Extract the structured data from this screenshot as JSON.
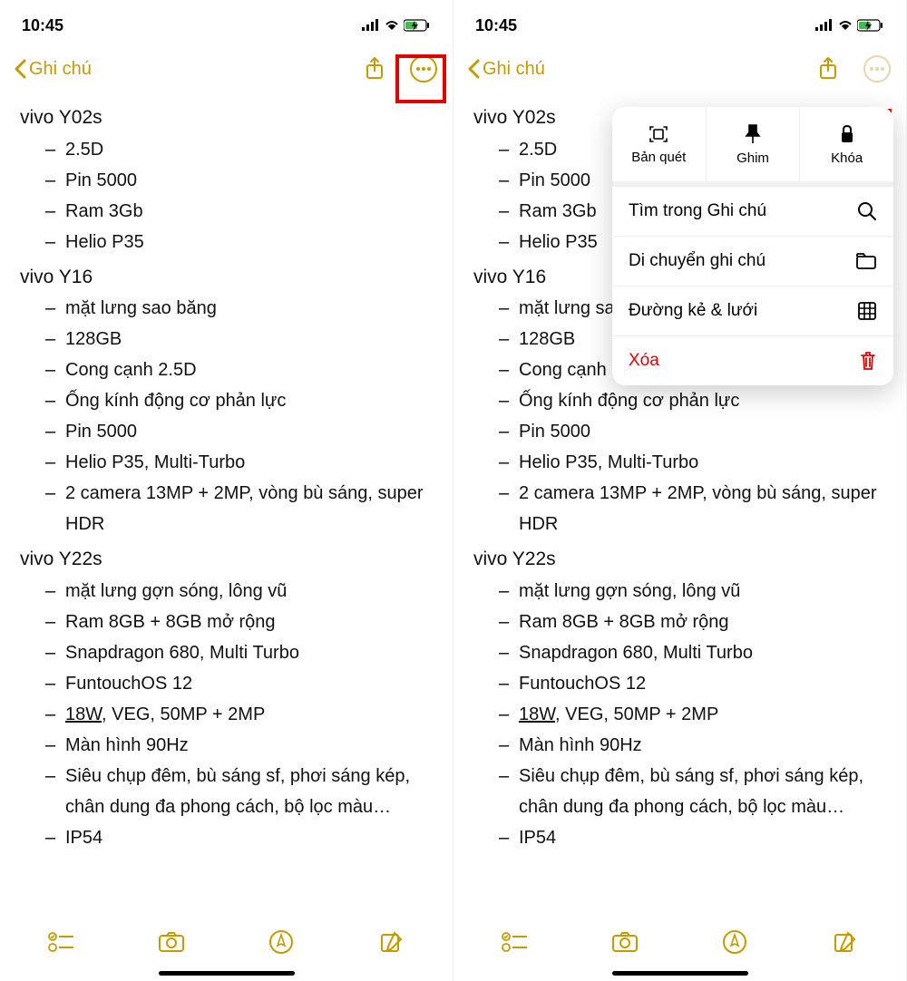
{
  "status": {
    "time": "10:45"
  },
  "nav": {
    "back_label": "Ghi chú"
  },
  "note": {
    "sections": [
      {
        "title": "vivo Y02s",
        "items": [
          "2.5D",
          "Pin 5000",
          "Ram 3Gb",
          "Helio P35"
        ]
      },
      {
        "title": "vivo Y16",
        "items": [
          "mặt lưng sao băng",
          "128GB",
          "Cong cạnh 2.5D",
          "Ống kính động cơ phản lực",
          "Pin 5000",
          "Helio P35, Multi-Turbo",
          "2 camera 13MP + 2MP, vòng bù sáng, super HDR"
        ]
      },
      {
        "title": "vivo Y22s",
        "items": [
          "mặt lưng gợn sóng, lông vũ",
          "Ram 8GB + 8GB mở rộng",
          "Snapdragon 680, Multi Turbo",
          "FuntouchOS 12",
          "<u>18W</u>, VEG, 50MP + 2MP",
          "Màn hình 90Hz",
          "Siêu chụp đêm, bù sáng sf, phơi sáng kép, chân dung đa phong cách, bộ lọc màu…",
          "IP54"
        ]
      }
    ]
  },
  "popup": {
    "top": [
      {
        "label": "Bản quét",
        "icon": "scan"
      },
      {
        "label": "Ghim",
        "icon": "pin"
      },
      {
        "label": "Khóa",
        "icon": "lock"
      }
    ],
    "rows": [
      {
        "label": "Tìm trong Ghi chú",
        "icon": "search"
      },
      {
        "label": "Di chuyển ghi chú",
        "icon": "folder"
      },
      {
        "label": "Đường kẻ & lưới",
        "icon": "grid"
      },
      {
        "label": "Xóa",
        "icon": "trash",
        "danger": true
      }
    ]
  },
  "colors": {
    "accent": "#c79a00",
    "danger": "#e30000"
  }
}
